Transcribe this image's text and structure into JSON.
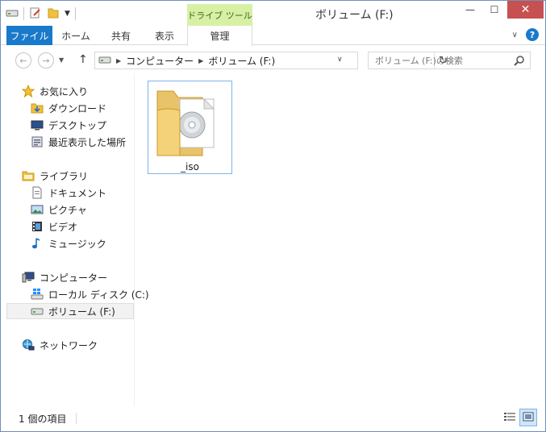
{
  "window": {
    "title": "ボリューム (F:)",
    "context_tab_group": "ドライブ ツール",
    "controls": {
      "minimize": "—",
      "maximize": "☐",
      "close": "✕"
    }
  },
  "ribbon": {
    "tabs": [
      {
        "label": "ファイル"
      },
      {
        "label": "ホーム"
      },
      {
        "label": "共有"
      },
      {
        "label": "表示"
      },
      {
        "label": "管理"
      }
    ],
    "help_label": "?"
  },
  "address": {
    "breadcrumb": [
      "コンピューター",
      "ボリューム (F:)"
    ]
  },
  "search": {
    "placeholder": "ボリューム (F:)の検索"
  },
  "nav_pane": {
    "favorites": {
      "label": "お気に入り",
      "items": [
        {
          "label": "ダウンロード"
        },
        {
          "label": "デスクトップ"
        },
        {
          "label": "最近表示した場所"
        }
      ]
    },
    "libraries": {
      "label": "ライブラリ",
      "items": [
        {
          "label": "ドキュメント"
        },
        {
          "label": "ピクチャ"
        },
        {
          "label": "ビデオ"
        },
        {
          "label": "ミュージック"
        }
      ]
    },
    "computer": {
      "label": "コンピューター",
      "items": [
        {
          "label": "ローカル ディスク (C:)"
        },
        {
          "label": "ボリューム (F:)",
          "selected": true
        }
      ]
    },
    "network": {
      "label": "ネットワーク"
    }
  },
  "content": {
    "items": [
      {
        "name": "_iso",
        "type": "folder"
      }
    ]
  },
  "status": {
    "item_count_text": "1 個の項目"
  },
  "colors": {
    "accent": "#1979ca",
    "context_tab": "#d7f0a6",
    "close_button": "#c75050",
    "selection_border": "#7eb4ea"
  }
}
